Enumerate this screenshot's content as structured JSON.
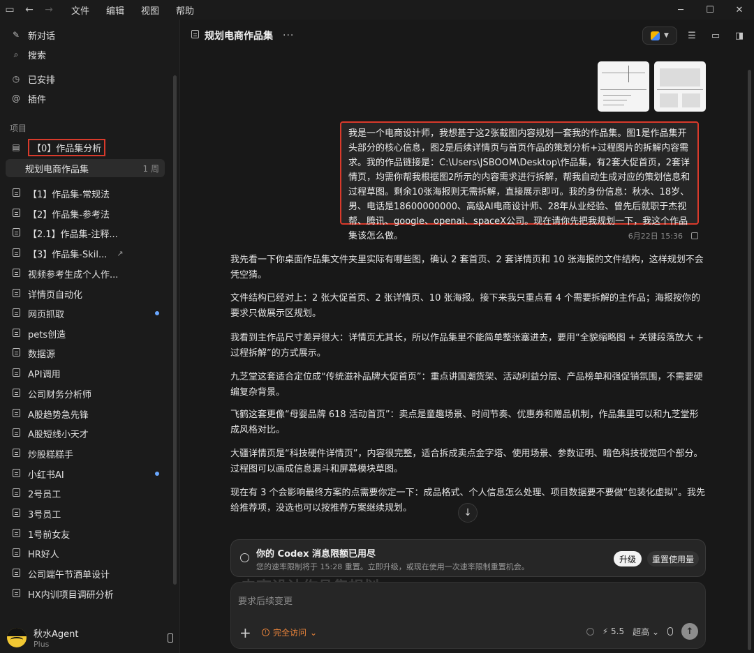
{
  "menu": [
    "文件",
    "编辑",
    "视图",
    "帮助"
  ],
  "sidebar": {
    "top": [
      {
        "label": "新对话",
        "icon": "new-chat-icon"
      },
      {
        "label": "搜索",
        "icon": "search-icon"
      },
      {
        "label": "已安排",
        "icon": "clock-icon"
      },
      {
        "label": "插件",
        "icon": "at-icon"
      }
    ],
    "section_label": "项目",
    "project_name": "【0】作品集分析",
    "active_thread": {
      "label": "规划电商作品集",
      "meta": "1 周"
    },
    "items": [
      "【1】作品集-常规法",
      "【2】作品集-参考法",
      "【2.1】作品集-注释...",
      "【3】作品集-Skil...",
      "视频参考生成个人作...",
      "详情页自动化",
      "网页抓取",
      "pets创造",
      "数据源",
      "API调用",
      "公司财务分析师",
      "A股趋势急先锋",
      "A股短线小天才",
      "炒股糕糕手",
      "小红书AI",
      "2号员工",
      "3号员工",
      "1号前女友",
      "HR好人",
      "公司端午节酒单设计",
      "HX内训项目调研分析"
    ],
    "user": {
      "name": "秋水Agent",
      "plan": "Plus"
    }
  },
  "main": {
    "title": "规划电商作品集",
    "user_message": "我是一个电商设计师，我想基于这2张截图内容规划一套我的作品集。图1是作品集开头部分的核心信息，图2是后续详情页与首页作品的策划分析+过程图片的拆解内容需求。我的作品链接是：C:\\Users\\JSBOOM\\Desktop\\作品集，有2套大促首页，2套详情页，均需你帮我根据图2所示的内容需求进行拆解，帮我自动生成对应的策划信息和过程草图。剩余10张海报则无需拆解，直接展示即可。我的身份信息：秋水、18岁、男、电话是18600000000、高级AI电商设计师、28年从业经验、曾先后就职于杰视帮、腾讯、google、openai、spaceX公司。现在请你先把我规划一下，我这个作品集该怎么做。",
    "message_time": "6月22日 15:36",
    "paragraphs": [
      "我先看一下你桌面作品集文件夹里实际有哪些图，确认 2 套首页、2 套详情页和 10 张海报的文件结构，这样规划不会凭空猜。",
      "文件结构已经对上：2 张大促首页、2 张详情页、10 张海报。接下来我只重点看 4 个需要拆解的主作品；海报按你的要求只做展示区规划。",
      "我看到主作品尺寸差异很大：详情页尤其长，所以作品集里不能简单整张塞进去，要用“全貌缩略图 + 关键段落放大 + 过程拆解”的方式展示。",
      "九芝堂这套适合定位成“传统滋补品牌大促首页”：重点讲国潮货架、活动利益分层、产品榜单和强促销氛围，不需要硬编复杂背景。",
      "飞鹤这套更像“母婴品牌 618 活动首页”：卖点是童趣场景、时间节奏、优惠券和赠品机制，作品集里可以和九芝堂形成风格对比。",
      "大疆详情页是“科技硬件详情页”，内容很完整，适合拆成卖点金字塔、使用场景、参数证明、暗色科技视觉四个部分。过程图可以画成信息漏斗和屏幕模块草图。",
      "现在有 3 个会影响最终方案的点需要你定一下：成品格式、个人信息怎么处理、项目数据要不要做“包装化虚拟”。我先给推荐项，没选也可以按推荐方案继续规划。"
    ],
    "banner": {
      "title": "你的 Codex 消息限额已用尽",
      "subtitle": "您的速率限制将于 15:28 重置。立即升级，或现在使用一次速率限制重置机会。",
      "upgrade_label": "升级",
      "reset_label": "重置使用量"
    },
    "ghost_text": "电商设计作品集规划",
    "composer": {
      "placeholder": "要求后续变更",
      "access_label": "完全访问",
      "model_version": "5.5",
      "effort_label": "超高"
    }
  }
}
